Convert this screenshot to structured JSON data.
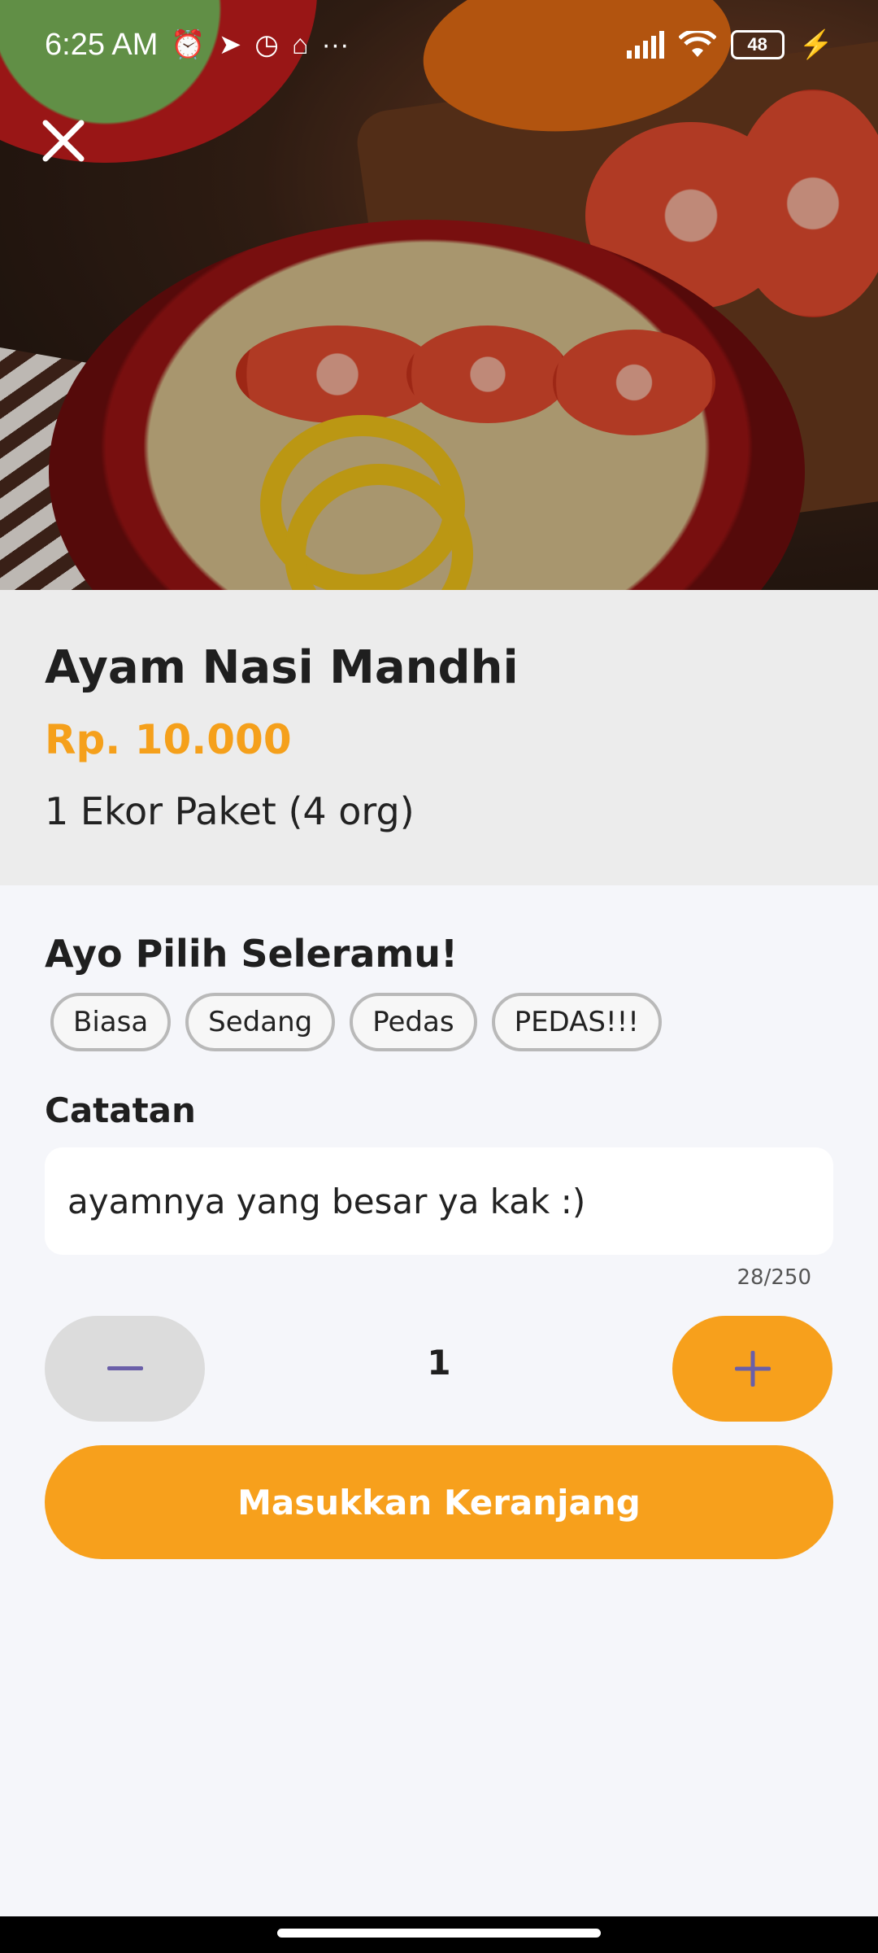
{
  "status_bar": {
    "time": "6:25 AM",
    "battery": "48",
    "icons": [
      "alarm-icon",
      "telegram-icon",
      "clock-icon",
      "notification-icon",
      "more-dots-icon",
      "signal-icon",
      "wifi-icon",
      "battery-icon",
      "charging-icon"
    ],
    "more": "···"
  },
  "product": {
    "name": "Ayam Nasi Mandhi",
    "price": "Rp. 10.000",
    "description": "1 Ekor Paket (4 org)"
  },
  "spice": {
    "label": "Ayo Pilih Seleramu!",
    "options": [
      "Biasa",
      "Sedang",
      "Pedas",
      "PEDAS!!!"
    ]
  },
  "note": {
    "label": "Catatan",
    "value": "ayamnya yang besar ya kak :)",
    "counter": "28/250"
  },
  "quantity": {
    "value": "1",
    "minus_icon": "minus-icon",
    "plus_icon": "plus-icon"
  },
  "cart_button": {
    "label": "Masukkan Keranjang"
  },
  "colors": {
    "accent": "#f7a01c",
    "price": "#f5a01b",
    "stepper_icon": "#6a5fa8"
  }
}
